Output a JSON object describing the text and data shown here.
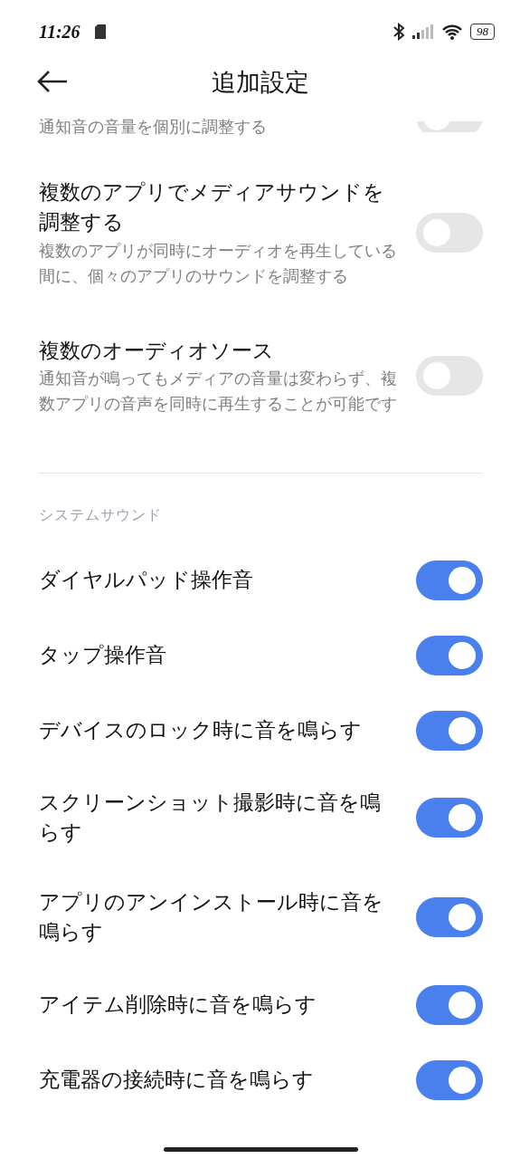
{
  "status_bar": {
    "time": "11:26",
    "battery": "98"
  },
  "header": {
    "title": "追加設定"
  },
  "sections": [
    {
      "items": [
        {
          "description": "通知音の音量を個別に調整する",
          "on": false
        },
        {
          "title": "複数のアプリでメディアサウンドを調整する",
          "description": "複数のアプリが同時にオーディオを再生している間に、個々のアプリのサウンドを調整する",
          "on": false
        },
        {
          "title": "複数のオーディオソース",
          "description": "通知音が鳴ってもメディアの音量は変わらず、複数アプリの音声を同時に再生することが可能です",
          "on": false
        }
      ]
    },
    {
      "heading": "システムサウンド",
      "items": [
        {
          "title": "ダイヤルパッド操作音",
          "on": true
        },
        {
          "title": "タップ操作音",
          "on": true
        },
        {
          "title": "デバイスのロック時に音を鳴らす",
          "on": true
        },
        {
          "title": "スクリーンショット撮影時に音を鳴らす",
          "on": true
        },
        {
          "title": "アプリのアンインストール時に音を鳴らす",
          "on": true
        },
        {
          "title": "アイテム削除時に音を鳴らす",
          "on": true
        },
        {
          "title": "充電器の接続時に音を鳴らす",
          "on": true
        }
      ]
    }
  ]
}
